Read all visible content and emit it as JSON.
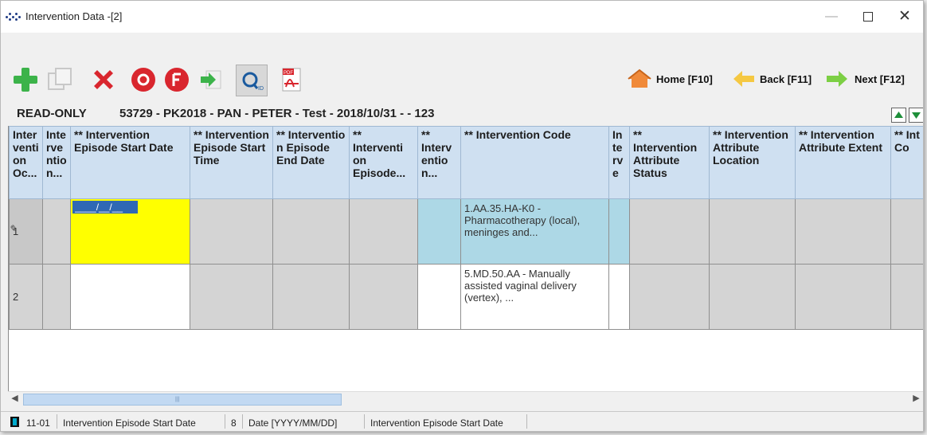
{
  "window": {
    "title": "Intervention Data -[2]",
    "minimize": "—",
    "maximize": "",
    "close": "✕"
  },
  "toolbar": {
    "tools": [
      {
        "name": "add-icon",
        "color": "#3cb34a"
      },
      {
        "name": "copy-icon",
        "color": "#d0d0d0"
      },
      {
        "name": "delete-icon",
        "color": "#d9262e"
      },
      {
        "name": "o-circle-icon",
        "color": "#d9262e"
      },
      {
        "name": "f-circle-icon",
        "color": "#d9262e"
      },
      {
        "name": "arrow-right-doc-icon",
        "color": "#3cb34a"
      },
      {
        "name": "query-icon",
        "color": "#1a5a9e"
      },
      {
        "name": "pdf-icon",
        "color": "#d9262e"
      }
    ],
    "home_label": "Home [F10]",
    "back_label": "Back [F11]",
    "next_label": "Next [F12]"
  },
  "record": {
    "mode": "READ-ONLY",
    "info": "53729 - PK2018 - PAN - PETER - Test - 2018/10/31 - - 123"
  },
  "grid": {
    "columns": [
      "Inter venti on Oc...",
      "Inte rve ntio n...",
      "** Intervention Episode Start Date",
      "** Intervention Episode Start Time",
      "** Interventio n Episode End Date",
      "** Interventi on Episode...",
      "** Interv entio n...",
      "** Intervention Code",
      "In te rv e",
      "** Intervention Attribute Status",
      "** Intervention Attribute Location",
      "** Intervention Attribute Extent",
      "** Int Lo Co"
    ],
    "rows": [
      {
        "num": "1",
        "start_date": "____/__/__",
        "code": "1.AA.35.HA-K0 - Pharmacotherapy (local), meninges and..."
      },
      {
        "num": "2",
        "start_date": "",
        "code": "5.MD.50.AA - Manually assisted vaginal delivery (vertex), ..."
      }
    ],
    "edit_marker": "✎"
  },
  "statusbar": {
    "code": "11-01",
    "field": "Intervention Episode Start Date",
    "length": "8",
    "format": "Date [YYYY/MM/DD]",
    "description": "Intervention Episode Start Date"
  },
  "colors": {
    "header": "#cfe0f1",
    "selected_cell": "#ffff00",
    "code_cell": "#add8e6",
    "accent": "#2f68b4"
  }
}
